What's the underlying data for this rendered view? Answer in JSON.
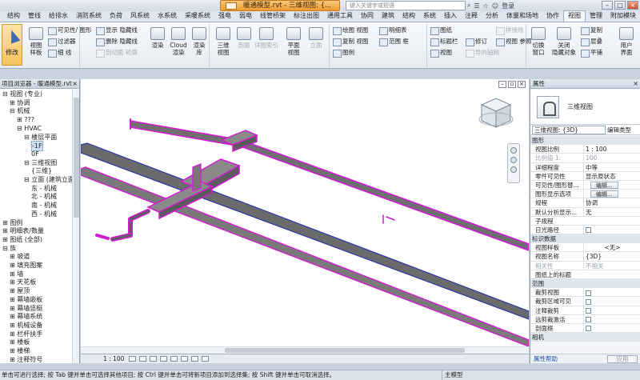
{
  "title_bar": {
    "doc_title": "暖通模型.rvt - 三维视图: {...",
    "search_placeholder": "键入关键字或短语",
    "login": "登录",
    "min": "–",
    "max": "□",
    "close": "×"
  },
  "ribbon_tabs": [
    "结构",
    "管线",
    "给排水",
    "消防系统",
    "负荷",
    "风系统",
    "水系统",
    "采暖系统",
    "强电",
    "弱电",
    "线管桥架",
    "标注出图",
    "通用工具",
    "协同",
    "建筑",
    "结构",
    "系统",
    "插入",
    "注释",
    "分析",
    "体量和场地",
    "协作",
    "视图",
    "管理",
    "附加模块"
  ],
  "active_tab_index": 22,
  "ribbon": {
    "modify": "修改",
    "view_template": "视图\n样板",
    "visibility_graphics": "可见性/ 图形",
    "filters": "过滤器",
    "thin_lines": "细 线",
    "show_hidden": "显示 隐藏线",
    "remove_hidden": "删除 隐藏线",
    "cut_profile": "剖切面 轮廓",
    "render": "渲染",
    "cloud_render": "Cloud\n渲染",
    "render_gallery": "渲染\n库",
    "three_d_view": "三维\n视图",
    "section": "剖面",
    "callout": "详图索引",
    "plan_views": "平面\n视图",
    "elevation": "立面",
    "drafting_view": "绘图 视图",
    "duplicate_view": "复制 视图",
    "legends": "图例",
    "schedules": "明细表",
    "scope_box": "范围 框",
    "sheet": "图纸",
    "title_block": "标题栏",
    "view_placement": "视图",
    "revisions": "修订",
    "guide_grid": "导向轴网",
    "matchline": "拼接线",
    "view_reference": "视图 参照",
    "switch_windows": "切换\n窗口",
    "close_hidden": "关闭\n隐藏对象",
    "replicate": "复制",
    "cascade": "层叠",
    "tile": "平铺",
    "user_interface": "用户\n界面"
  },
  "project_browser": {
    "header": "项目浏览器 - 暖通模型.rvt",
    "close": "×",
    "nodes": [
      {
        "label": "视图 (专业)",
        "indent": 0,
        "toggle": "⊟"
      },
      {
        "label": "协调",
        "indent": 1,
        "toggle": "⊞"
      },
      {
        "label": "机械",
        "indent": 1,
        "toggle": "⊟"
      },
      {
        "label": "???",
        "indent": 2,
        "toggle": "⊞"
      },
      {
        "label": "HVAC",
        "indent": 2,
        "toggle": "⊟"
      },
      {
        "label": "楼层平面",
        "indent": 3,
        "toggle": "⊟"
      },
      {
        "label": "-1F",
        "indent": 4,
        "toggle": ""
      },
      {
        "label": "0F",
        "indent": 4,
        "toggle": ""
      },
      {
        "label": "三维视图",
        "indent": 3,
        "toggle": "⊟"
      },
      {
        "label": "{三维}",
        "indent": 4,
        "toggle": ""
      },
      {
        "label": "立面 (建筑立面",
        "indent": 3,
        "toggle": "⊟"
      },
      {
        "label": "东 - 机械",
        "indent": 4,
        "toggle": ""
      },
      {
        "label": "北 - 机械",
        "indent": 4,
        "toggle": ""
      },
      {
        "label": "南 - 机械",
        "indent": 4,
        "toggle": ""
      },
      {
        "label": "西 - 机械",
        "indent": 4,
        "toggle": ""
      },
      {
        "label": "图例",
        "indent": 0,
        "toggle": "⊞"
      },
      {
        "label": "明细表/数量",
        "indent": 0,
        "toggle": "⊞"
      },
      {
        "label": "图纸 (全部)",
        "indent": 0,
        "toggle": "⊞"
      },
      {
        "label": "族",
        "indent": 0,
        "toggle": "⊟"
      },
      {
        "label": "坡道",
        "indent": 1,
        "toggle": "⊞"
      },
      {
        "label": "填充图案",
        "indent": 1,
        "toggle": "⊞"
      },
      {
        "label": "墙",
        "indent": 1,
        "toggle": "⊞"
      },
      {
        "label": "天花板",
        "indent": 1,
        "toggle": "⊞"
      },
      {
        "label": "屋顶",
        "indent": 1,
        "toggle": "⊞"
      },
      {
        "label": "幕墙嵌板",
        "indent": 1,
        "toggle": "⊞"
      },
      {
        "label": "幕墙竖梃",
        "indent": 1,
        "toggle": "⊞"
      },
      {
        "label": "幕墙系统",
        "indent": 1,
        "toggle": "⊞"
      },
      {
        "label": "机械设备",
        "indent": 1,
        "toggle": "⊞"
      },
      {
        "label": "栏杆扶手",
        "indent": 1,
        "toggle": "⊞"
      },
      {
        "label": "楼板",
        "indent": 1,
        "toggle": "⊞"
      },
      {
        "label": "楼梯",
        "indent": 1,
        "toggle": "⊞"
      },
      {
        "label": "注释符号",
        "indent": 1,
        "toggle": "⊞"
      }
    ],
    "selected_index": 6
  },
  "viewport": {
    "scale": "1 : 100",
    "highlight_color": "#d21ad2",
    "duct_color": "#6b6b6b",
    "edge_color": "#2a36a8"
  },
  "properties": {
    "header": "属性",
    "close": "×",
    "type_name": "三维视图",
    "instance": "三维视图: {3D}",
    "edit_type": "编辑类型",
    "rows": [
      {
        "kind": "cat",
        "k": "图形"
      },
      {
        "k": "视图比例",
        "v": "1 : 100"
      },
      {
        "k": "比例值 1:",
        "v": "100",
        "dim": true
      },
      {
        "k": "详细程度",
        "v": "中等"
      },
      {
        "k": "零件可见性",
        "v": "显示原状态"
      },
      {
        "k": "可见性/图形替...",
        "v": "编辑...",
        "btn": true
      },
      {
        "k": "图形显示选项",
        "v": "编辑...",
        "btn": true
      },
      {
        "k": "规程",
        "v": "协调"
      },
      {
        "k": "默认分析显示...",
        "v": "无"
      },
      {
        "k": "子规程",
        "v": ""
      },
      {
        "k": "日光路径",
        "v": "",
        "chk": true
      },
      {
        "kind": "cat",
        "k": "标识数据"
      },
      {
        "k": "视图样板",
        "v": "<无>",
        "center": true
      },
      {
        "k": "视图名称",
        "v": "{3D}"
      },
      {
        "k": "相关性",
        "v": "不相关",
        "dim": true
      },
      {
        "k": "图纸上的标题",
        "v": ""
      },
      {
        "kind": "cat",
        "k": "范围"
      },
      {
        "k": "裁剪视图",
        "v": "",
        "chk": true
      },
      {
        "k": "裁剪区域可见",
        "v": "",
        "chk": true
      },
      {
        "k": "注释裁剪",
        "v": "",
        "chk": true
      },
      {
        "k": "远剪裁激活",
        "v": "",
        "chk": true
      },
      {
        "k": "剖面框",
        "v": "",
        "chk": true
      },
      {
        "kind": "cat",
        "k": "相机"
      }
    ],
    "help": "属性帮助",
    "apply": "应用"
  },
  "status_bar": {
    "message": "单击可进行选择; 按 Tab 键并单击可选择其他项目; 按 Ctrl 键并单击可将新项目添加到选择集; 按 Shift 键并单击可取消选择。",
    "main_model": "主模型"
  }
}
